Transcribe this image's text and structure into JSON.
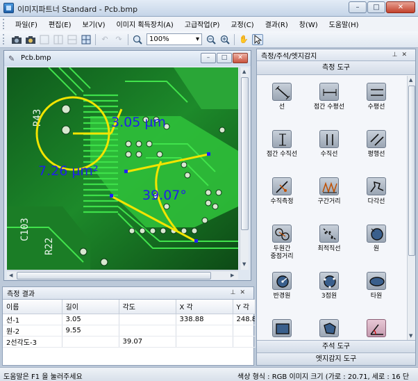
{
  "window": {
    "title": "이미지파트너 Standard - Pcb.bmp",
    "minimize": "–",
    "maximize": "□",
    "close": "✕"
  },
  "menu": [
    "파일(F)",
    "편집(E)",
    "보기(V)",
    "이미지 획득장치(A)",
    "고급작업(P)",
    "교정(C)",
    "결과(R)",
    "창(W)",
    "도움말(H)"
  ],
  "toolbar": {
    "zoom_value": "100%"
  },
  "image_window": {
    "filename": "Pcb.bmp",
    "labels": {
      "circle_measure": "3.05 µm",
      "area_measure": "7.26 µm²",
      "angle_measure": "39.07°"
    }
  },
  "results": {
    "title": "측정 결과",
    "columns": [
      "이름",
      "길이",
      "각도",
      "X 각",
      "Y 각"
    ],
    "rows": [
      [
        "선-1",
        "3.05",
        "",
        "338.88",
        "248.8"
      ],
      [
        "원-2",
        "9.55",
        "",
        "",
        ""
      ],
      [
        "2선각도-3",
        "",
        "39.07",
        "",
        ""
      ]
    ]
  },
  "dock": {
    "title": "측정/주석/엣지감지",
    "section_measure": "측정 도구",
    "tools": [
      {
        "label": "선",
        "icon": "line-icon"
      },
      {
        "label": "점간 수평선",
        "icon": "point-horizontal-line-icon"
      },
      {
        "label": "수평선",
        "icon": "horizontal-line-icon"
      },
      {
        "label": "점간 수직선",
        "icon": "point-vertical-line-icon"
      },
      {
        "label": "수직선",
        "icon": "vertical-line-icon"
      },
      {
        "label": "평행선",
        "icon": "parallel-line-icon"
      },
      {
        "label": "수직측정",
        "icon": "perpendicular-measure-icon"
      },
      {
        "label": "구간거리",
        "icon": "segment-distance-icon"
      },
      {
        "label": "다각선",
        "icon": "polyline-icon"
      },
      {
        "label": "두원간\n중점거리",
        "icon": "two-circle-center-distance-icon"
      },
      {
        "label": "최적직선",
        "icon": "best-fit-line-icon"
      },
      {
        "label": "원",
        "icon": "circle-icon"
      },
      {
        "label": "반경원",
        "icon": "radius-circle-icon"
      },
      {
        "label": "3점원",
        "icon": "three-point-circle-icon"
      },
      {
        "label": "타원",
        "icon": "ellipse-icon"
      },
      {
        "label": "",
        "icon": "rectangle-icon"
      },
      {
        "label": "",
        "icon": "polygon-icon"
      },
      {
        "label": "",
        "icon": "angle-icon"
      }
    ],
    "section_annotation": "주석 도구",
    "section_edge": "엣지감지 도구"
  },
  "status": {
    "help": "도움말은 F1 을 눌러주세요",
    "info": "색상 형식 : RGB  이미지 크기 (가로 : 20.71, 세로 : 16 단"
  }
}
